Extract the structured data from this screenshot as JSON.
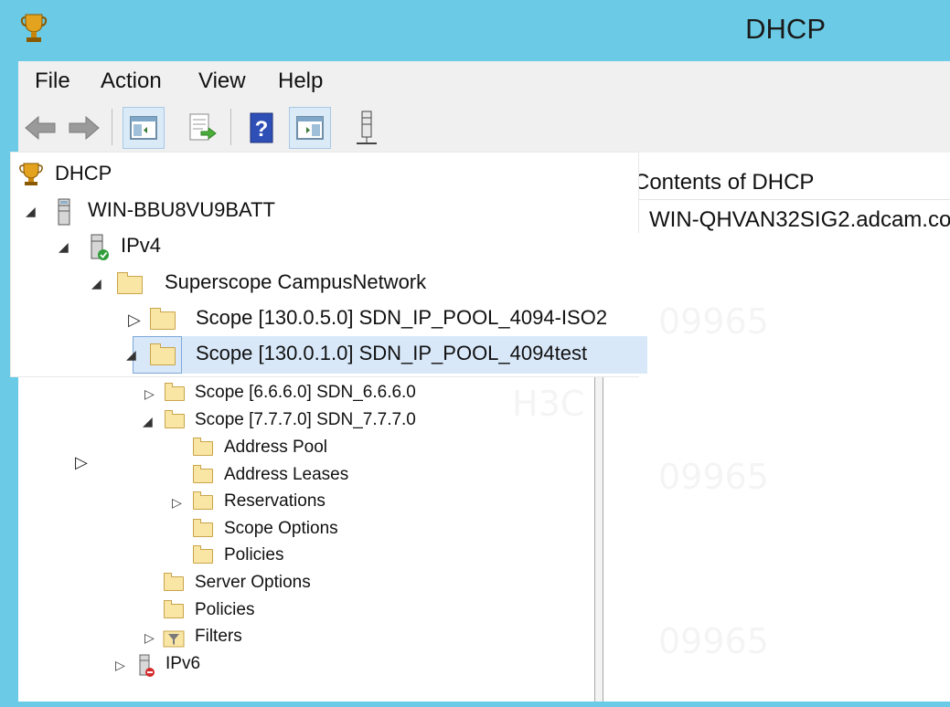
{
  "window": {
    "title": "DHCP",
    "app_icon": "dhcp-trophy-icon"
  },
  "menu": [
    "File",
    "Action",
    "View",
    "Help"
  ],
  "toolbar": [
    {
      "name": "back-button",
      "icon": "arrow-left-icon"
    },
    {
      "name": "forward-button",
      "icon": "arrow-right-icon"
    },
    {
      "name": "show-hide-console-tree-button",
      "icon": "console-tree-icon",
      "pressed": true
    },
    {
      "name": "export-list-button",
      "icon": "export-list-icon"
    },
    {
      "name": "help-button",
      "icon": "help-icon"
    },
    {
      "name": "show-hide-action-pane-button",
      "icon": "action-pane-icon",
      "pressed": true
    },
    {
      "name": "server-status-button",
      "icon": "server-status-icon"
    }
  ],
  "tree": {
    "root": "DHCP",
    "server": "WIN-BBU8VU9BATT",
    "ipv4": "IPv4",
    "superscope": "Superscope CampusNetwork",
    "scope_iso2": "Scope [130.0.5.0]  SDN_IP_POOL_4094-ISO2",
    "scope_test": "Scope [130.0.1.0]  SDN_IP_POOL_4094test",
    "scope_666": "Scope [6.6.6.0] SDN_6.6.6.0",
    "scope_777": "Scope [7.7.7.0] SDN_7.7.7.0",
    "address_pool": "Address Pool",
    "address_leases": "Address Leases",
    "reservations": "Reservations",
    "scope_options": "Scope Options",
    "scope_policies": "Policies",
    "server_options": "Server Options",
    "policies": "Policies",
    "filters": "Filters",
    "ipv6": "IPv6"
  },
  "right_pane": {
    "header": "Contents of DHCP",
    "item": "WIN-QHVAN32SIG2.adcam.co"
  },
  "colors": {
    "titlebar": "#6bcbe6",
    "selection": "#d9e8f9",
    "toolbar": "#f0f0f0"
  }
}
